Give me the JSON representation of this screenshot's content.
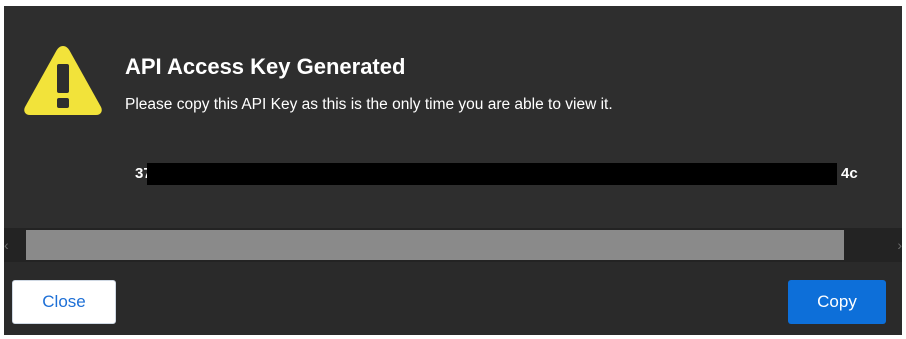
{
  "dialog": {
    "title": "API Access Key Generated",
    "message": "Please copy this API Key as this is the only time you are able to view it.",
    "icon": "warning-icon",
    "key": {
      "visible_start": "37",
      "visible_end": "4c"
    },
    "scrollbar": {
      "left_arrow": "‹",
      "right_arrow": "›"
    },
    "buttons": {
      "close_label": "Close",
      "copy_label": "Copy"
    },
    "colors": {
      "background": "#2e2e2e",
      "warning": "#f2e33a",
      "primary": "#0d6fd9"
    }
  }
}
